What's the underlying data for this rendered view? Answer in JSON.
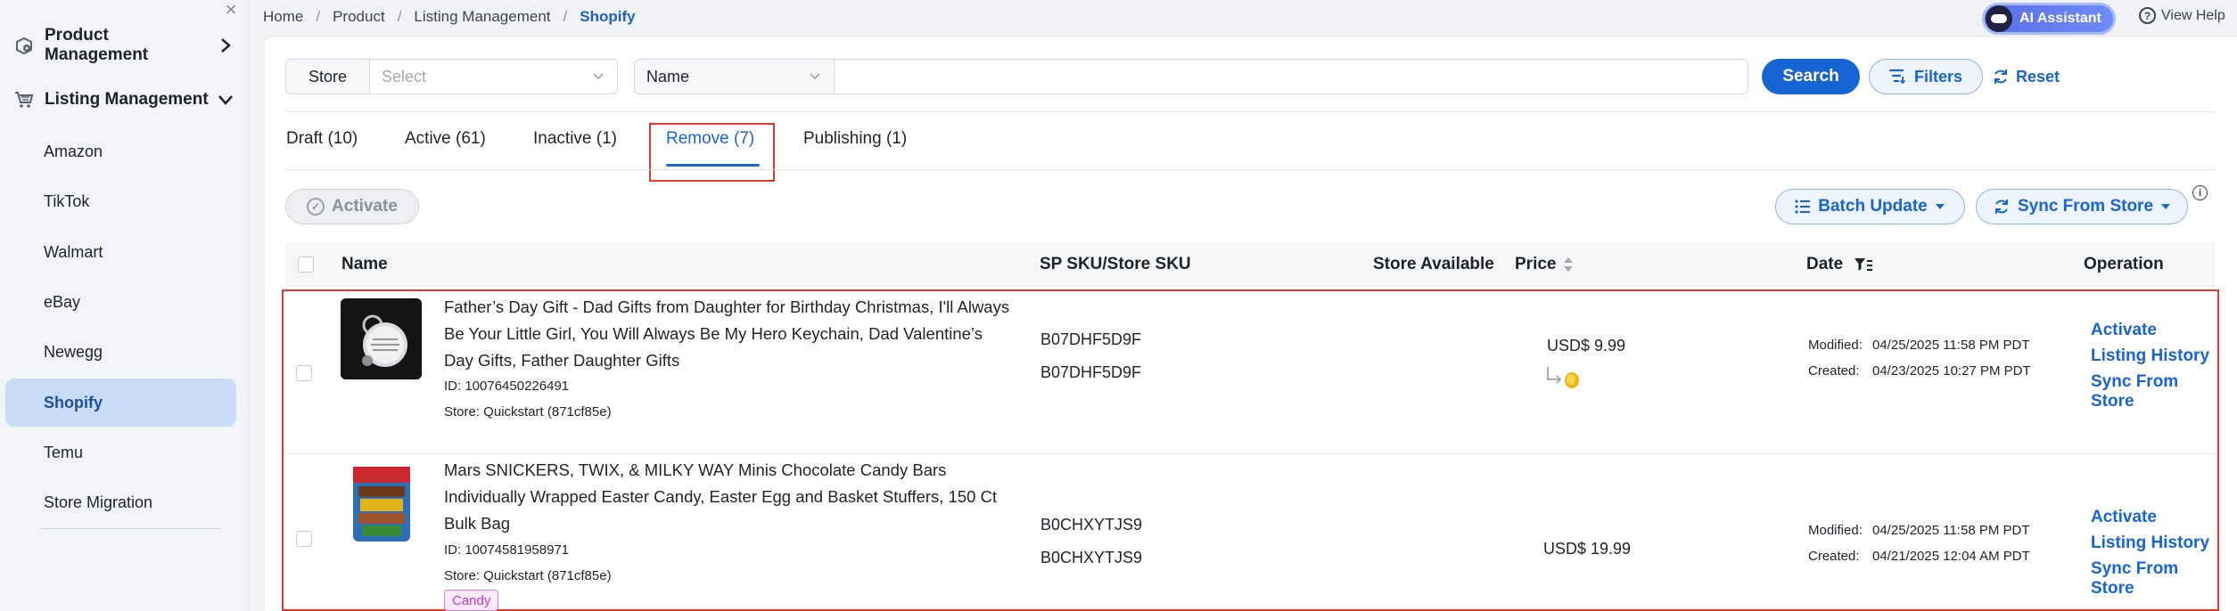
{
  "sidebar": {
    "close_glyph": "×",
    "groups": [
      {
        "label": "Product Management",
        "icon": "product-box-icon"
      },
      {
        "label": "Listing Management",
        "icon": "cart-icon"
      }
    ],
    "items": [
      {
        "label": "Amazon"
      },
      {
        "label": "TikTok"
      },
      {
        "label": "Walmart"
      },
      {
        "label": "eBay"
      },
      {
        "label": "Newegg"
      },
      {
        "label": "Shopify",
        "active": true
      },
      {
        "label": "Temu"
      },
      {
        "label": "Store Migration"
      }
    ]
  },
  "breadcrumb": [
    "Home",
    "Product",
    "Listing Management",
    "Shopify"
  ],
  "breadcrumb_sep": "/",
  "header": {
    "ai_assistant": "AI Assistant",
    "view_help": "View Help",
    "help_glyph": "?"
  },
  "search": {
    "store_label": "Store",
    "store_placeholder": "Select",
    "field_select": "Name",
    "field_value": "",
    "search_button": "Search",
    "filters_button": "Filters",
    "reset_button": "Reset"
  },
  "tabs": [
    {
      "label": "Draft (10)"
    },
    {
      "label": "Active (61)"
    },
    {
      "label": "Inactive (1)"
    },
    {
      "label": "Remove (7)",
      "active": true
    },
    {
      "label": "Publishing (1)"
    }
  ],
  "toolbar": {
    "activate": "Activate",
    "batch_update": "Batch Update",
    "sync_from_store": "Sync From Store",
    "info_glyph": "i"
  },
  "table": {
    "columns": [
      "Name",
      "SP SKU/Store SKU",
      "Store Available",
      "Price",
      "Date",
      "Operation"
    ],
    "rows": [
      {
        "name": "Father’s Day Gift - Dad Gifts from Daughter for Birthday Christmas, I'll Always Be Your Little Girl, You Will Always Be My Hero Keychain, Dad Valentine’s Day Gifts, Father Daughter Gifts",
        "id": "ID: 10076450226491",
        "store": "Store: Quickstart (871cf85e)",
        "sp_sku": "B07DHF5D9F",
        "store_sku": "B07DHF5D9F",
        "price": "USD$ 9.99",
        "modified_label": "Modified:",
        "modified": "04/25/2025 11:58 PM PDT",
        "created_label": "Created:",
        "created": "04/23/2025 10:27 PM PDT",
        "operations": [
          "Activate",
          "Listing History",
          "Sync From Store"
        ]
      },
      {
        "name": "Mars SNICKERS, TWIX, & MILKY WAY Minis Chocolate Candy Bars Individually Wrapped Easter Candy, Easter Egg and Basket Stuffers, 150 Ct Bulk Bag",
        "id": "ID: 10074581958971",
        "store": "Store: Quickstart (871cf85e)",
        "tag": "Candy",
        "sp_sku": "B0CHXYTJS9",
        "store_sku": "B0CHXYTJS9",
        "price": "USD$ 19.99",
        "modified_label": "Modified:",
        "modified": "04/25/2025 11:58 PM PDT",
        "created_label": "Created:",
        "created": "04/21/2025 12:04 AM PDT",
        "operations": [
          "Activate",
          "Listing History",
          "Sync From Store"
        ]
      }
    ]
  },
  "colors": {
    "accent": "#1764d4",
    "highlight_border": "#e0392b",
    "sidebar_active": "#c9dcf6",
    "tag_magenta": "#c238c9"
  }
}
